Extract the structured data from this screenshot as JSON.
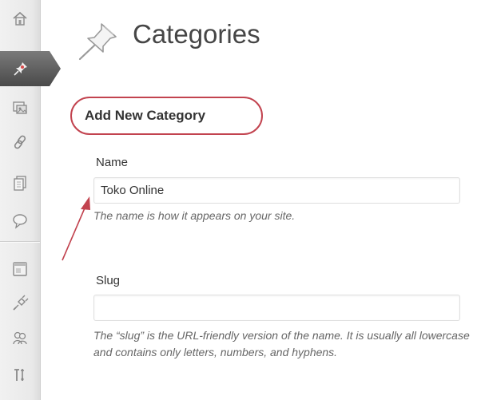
{
  "sidebar": {
    "items": [
      {
        "name": "dashboard",
        "icon": "home-icon"
      },
      {
        "name": "posts",
        "icon": "pushpin-icon",
        "active": true
      },
      {
        "name": "media",
        "icon": "media-icon"
      },
      {
        "name": "links",
        "icon": "link-icon"
      },
      {
        "name": "pages",
        "icon": "pages-icon"
      },
      {
        "name": "comments",
        "icon": "comments-icon"
      },
      {
        "name": "appearance",
        "icon": "appearance-icon"
      },
      {
        "name": "plugins",
        "icon": "plugin-icon"
      },
      {
        "name": "users",
        "icon": "users-icon"
      },
      {
        "name": "tools",
        "icon": "tools-icon"
      }
    ]
  },
  "page": {
    "title": "Categories",
    "title_icon": "pushpin-icon"
  },
  "form": {
    "heading": "Add New Category",
    "name": {
      "label": "Name",
      "value": "Toko Online",
      "help": "The name is how it appears on your site."
    },
    "slug": {
      "label": "Slug",
      "value": "",
      "help": "The “slug” is the URL-friendly version of the name. It is usually all lowercase and contains only letters, numbers, and hyphens."
    }
  },
  "colors": {
    "highlight": "#c2434f",
    "active_nav": "#5b5b5b"
  }
}
